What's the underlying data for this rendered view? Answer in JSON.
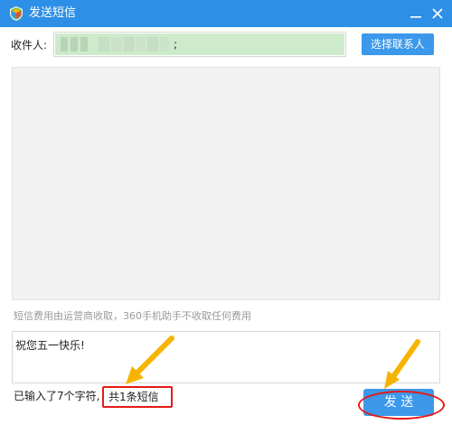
{
  "window": {
    "title": "发送短信",
    "icons": {
      "app": "360-shield-icon",
      "minimize": "minimize-icon",
      "close": "close-icon"
    }
  },
  "recipient": {
    "label": "收件人:",
    "value_separator": ";",
    "pick_contacts_button": "选择联系人"
  },
  "notice": {
    "fee_text": "短信费用由运营商收取，360手机助手不收取任何费用"
  },
  "message": {
    "content": "祝您五一快乐!"
  },
  "status": {
    "typed_count": "已输入了7个字符,",
    "sms_count": "共1条短信"
  },
  "actions": {
    "send_button": "发 送"
  },
  "colors": {
    "titlebar": "#2e8fe6",
    "primary_button": "#3c98ea",
    "highlight_red": "#e41b17",
    "annotation_arrow": "#f6b400",
    "recipient_fill": "#cdebcb"
  }
}
